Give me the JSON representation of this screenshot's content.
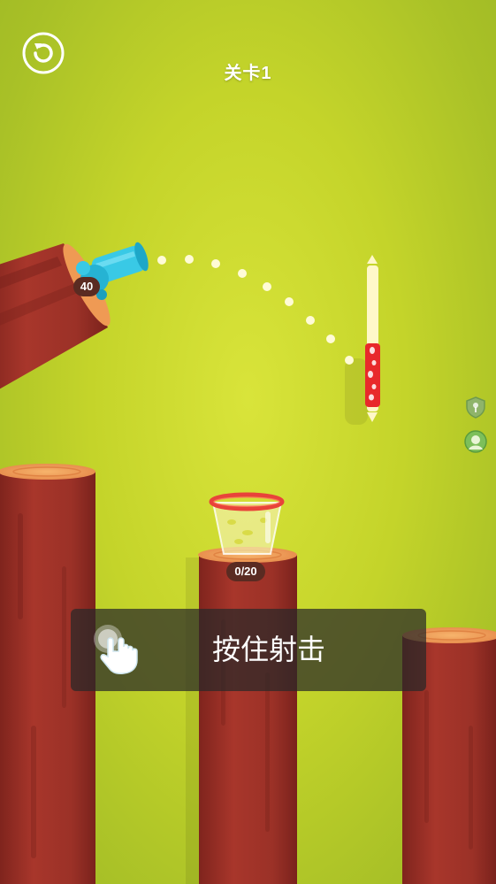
{
  "hud": {
    "level_label": "关卡1"
  },
  "cannon": {
    "ammo_count": "40",
    "color": "#39c9e6"
  },
  "cup": {
    "fill_counter": "0/20",
    "rim_color": "#e8433a"
  },
  "power_meter": {
    "level": 0.45,
    "fill_color": "#e8292b"
  },
  "tutorial": {
    "hint_text": "按住射击"
  },
  "side_icons": [
    "shield-icon",
    "avatar-icon"
  ],
  "colors": {
    "background": "#c4d42a",
    "log": "#9b3127",
    "log_top": "#f2a35f"
  }
}
